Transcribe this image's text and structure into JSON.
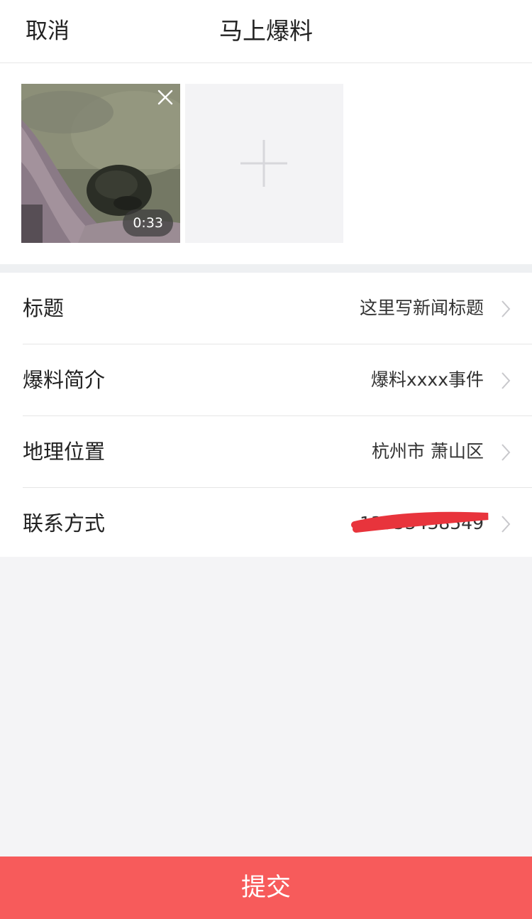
{
  "nav": {
    "cancel_label": "取消",
    "title": "马上爆料"
  },
  "media": {
    "video": {
      "duration": "0:33",
      "remove_icon": "close-icon"
    },
    "add_icon": "plus-icon"
  },
  "form": {
    "rows": [
      {
        "label": "标题",
        "value": "这里写新闻标题"
      },
      {
        "label": "爆料简介",
        "value": "爆料xxxx事件"
      },
      {
        "label": "地理位置",
        "value": "杭州市 萧山区"
      },
      {
        "label": "联系方式",
        "value": "13553438549"
      }
    ]
  },
  "submit_label": "提交",
  "colors": {
    "accent": "#f75b5b",
    "redaction": "#e8343c"
  }
}
